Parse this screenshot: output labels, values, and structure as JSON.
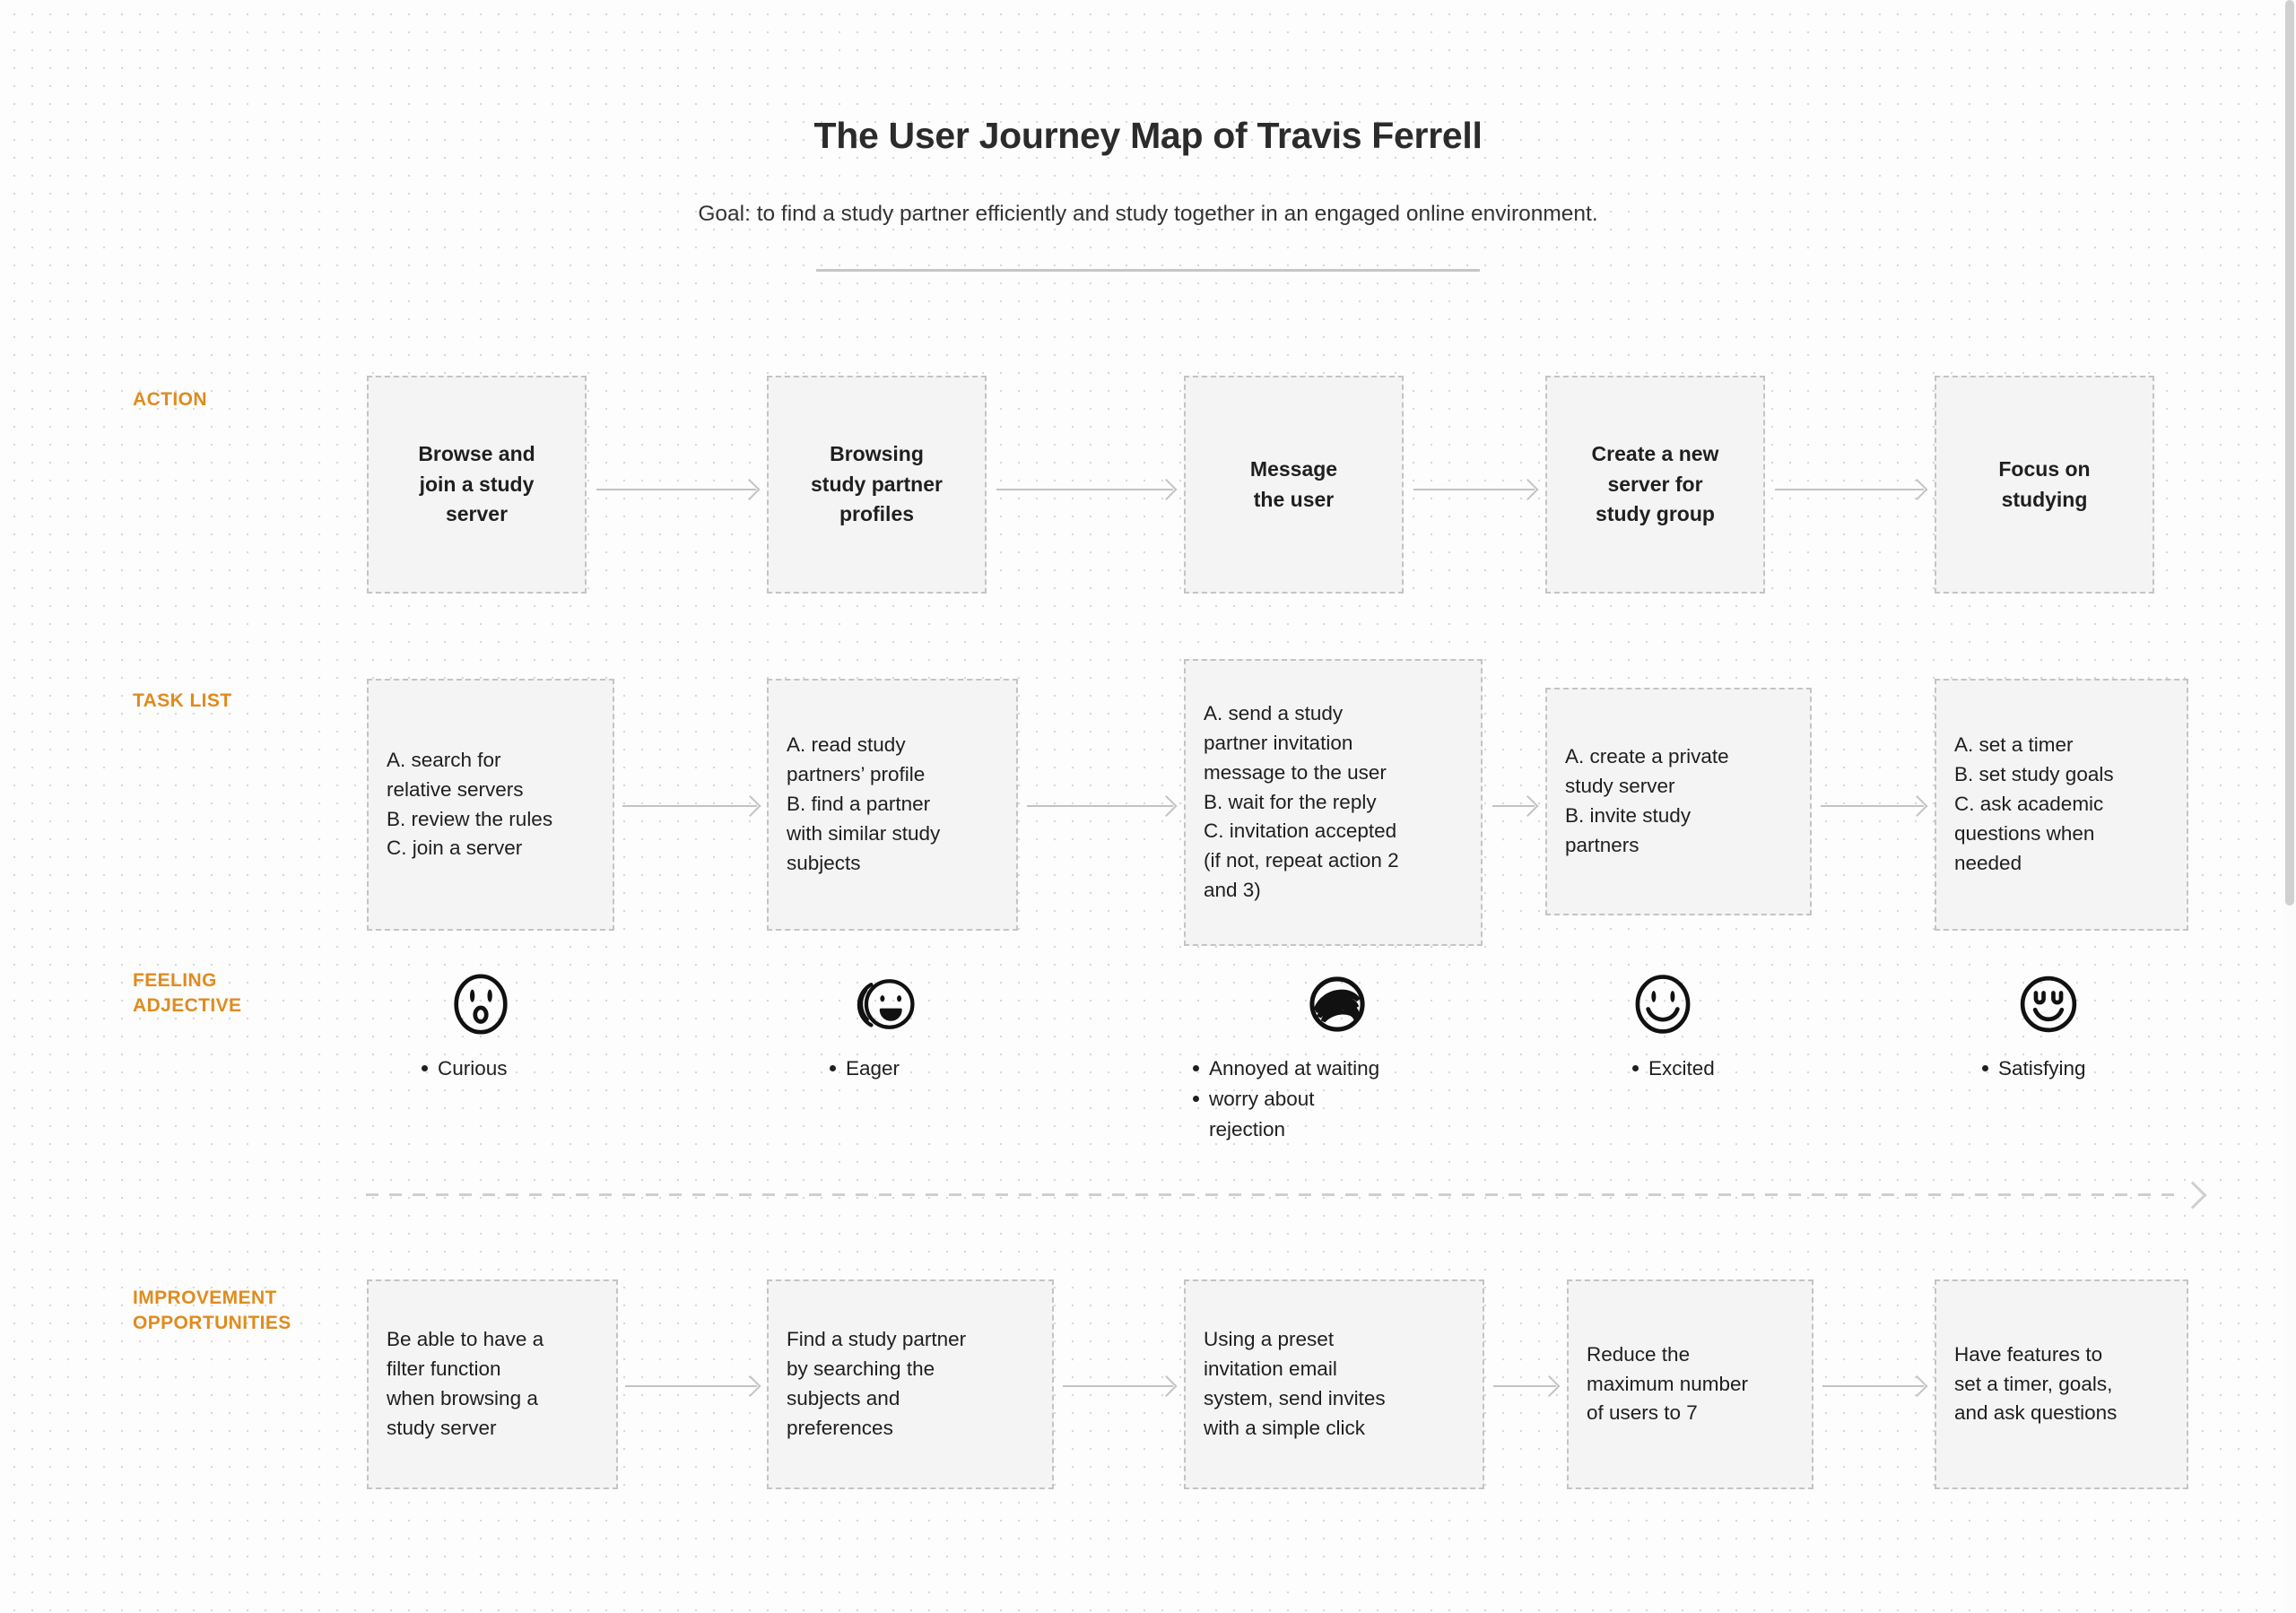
{
  "header": {
    "title": "The User Journey Map of Travis Ferrell",
    "subtitle": "Goal: to find a study partner efficiently and study together in an engaged online environment."
  },
  "colors": {
    "row_label": "#e08b1e",
    "box_fill": "#f4f4f4",
    "box_border": "#c4c4c4",
    "arrow": "#c3c3c3",
    "text": "#1f1f1f"
  },
  "rows": {
    "action": {
      "label": "ACTION",
      "items": [
        "Browse and\njoin a study\nserver",
        "Browsing\nstudy partner\nprofiles",
        "Message\nthe user",
        "Create a new\nserver for\nstudy group",
        "Focus on\nstudying"
      ]
    },
    "task_list": {
      "label": "TASK LIST",
      "items": [
        "A. search for\nrelative servers\nB. review the rules\nC. join a server",
        "A. read study\npartners’ profile\nB. find a partner\nwith similar study\nsubjects",
        "A. send a study\npartner invitation\nmessage to the user\nB. wait for the reply\nC. invitation accepted\n(if not, repeat action 2\nand 3)",
        "A. create a private\nstudy server\nB. invite study\npartners",
        "A. set a timer\nB. set study goals\nC. ask academic\nquestions when\nneeded"
      ]
    },
    "feeling": {
      "label": "FEELING\nADJECTIVE",
      "items": [
        {
          "icon": "curious-face-icon",
          "feelings": [
            "Curious"
          ]
        },
        {
          "icon": "eager-face-icon",
          "feelings": [
            "Eager"
          ]
        },
        {
          "icon": "annoyed-scribble-face-icon",
          "feelings": [
            "Annoyed at waiting",
            "worry about rejection"
          ]
        },
        {
          "icon": "excited-smiley-face-icon",
          "feelings": [
            "Excited"
          ]
        },
        {
          "icon": "satisfied-face-icon",
          "feelings": [
            "Satisfying"
          ]
        }
      ]
    },
    "improvement": {
      "label": "IMPROVEMENT\nOPPORTUNITIES",
      "items": [
        "Be able to have a\nfilter function\nwhen browsing a\nstudy server",
        "Find a study partner\nby searching the\nsubjects and\npreferences",
        "Using a preset\ninvitation email\nsystem, send invites\nwith a simple click",
        "Reduce the\nmaximum number\nof users to 7",
        "Have features to\nset a timer, goals,\nand ask questions"
      ]
    }
  }
}
